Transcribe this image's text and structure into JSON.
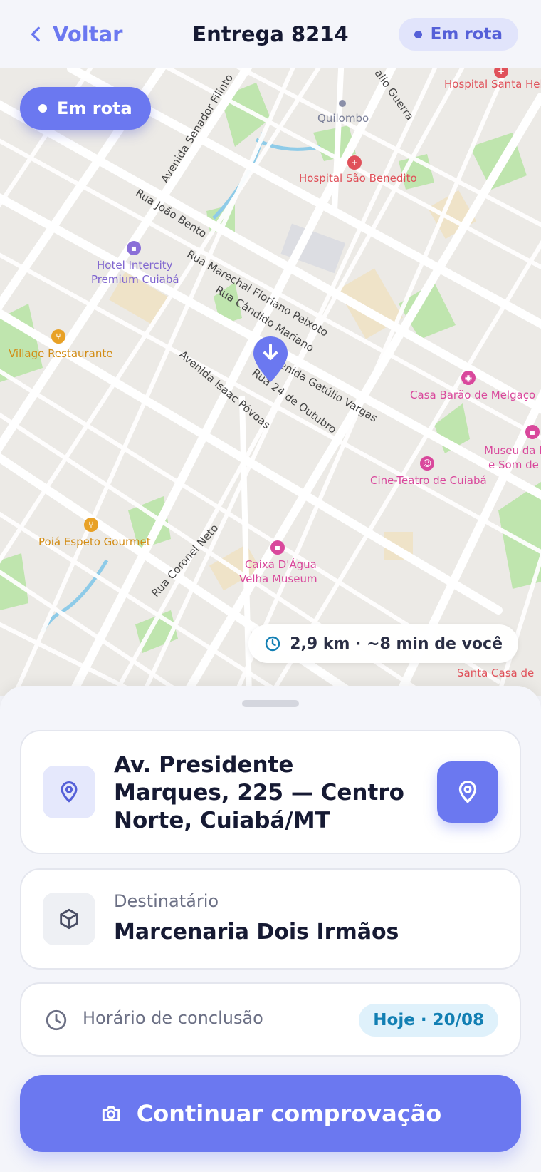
{
  "header": {
    "back_label": "Voltar",
    "title": "Entrega 8214",
    "status": "Em rota"
  },
  "map": {
    "status_chip": "Em rota",
    "eta": "2,9 km · ~8 min de você",
    "streets": [
      "Avenida Senador Filinto",
      "Rua João Bento",
      "Rua Marechal Floriano Peixoto",
      "Rua Cândido Mariano",
      "Avenida Getúlio Vargas",
      "Avenida Isaac Póvoas",
      "Rua 24 de Outubro",
      "Rua Coronel Neto",
      "alio Guerra"
    ],
    "pois": {
      "hospital_santa": "Hospital Santa Hele",
      "quilombo": "Quilombo",
      "hospital_sao_benedito": "Hospital São Benedito",
      "hotel_line1": "Hotel Intercity",
      "hotel_line2": "Premium Cuiabá",
      "village": "Village Restaurante",
      "casa_barao": "Casa Barão de Melgaço",
      "museu_line1": "Museu da I",
      "museu_line2": "e Som de C",
      "cine_teatro": "Cine-Teatro de Cuiabá",
      "poia": "Poiá Espeto Gourmet",
      "caixa_line1": "Caixa D'Água",
      "caixa_line2": "Velha Museum",
      "santa_casa": "Santa Casa de"
    }
  },
  "sheet": {
    "address": "Av. Presidente Marques, 225 — Centro Norte, Cuiabá/MT",
    "recipient_label": "Destinatário",
    "recipient_name": "Marcenaria Dois Irmãos",
    "time_label": "Horário de conclusão",
    "time_value": "Hoje · 20/08",
    "cta_label": "Continuar comprovação"
  },
  "colors": {
    "accent": "#6b78f0",
    "badge_bg": "#dff1fb",
    "badge_text": "#127fb3",
    "map_bg": "#eceae6",
    "park": "#b9e3a8",
    "poi_pink": "#d9489c",
    "poi_red": "#e0515a",
    "poi_orange": "#e8a126",
    "poi_purple": "#8a6fd8"
  },
  "icons": {
    "back": "chevron-left-icon",
    "location": "map-pin-icon",
    "package": "box-icon",
    "clock": "clock-icon",
    "camera": "camera-icon"
  }
}
